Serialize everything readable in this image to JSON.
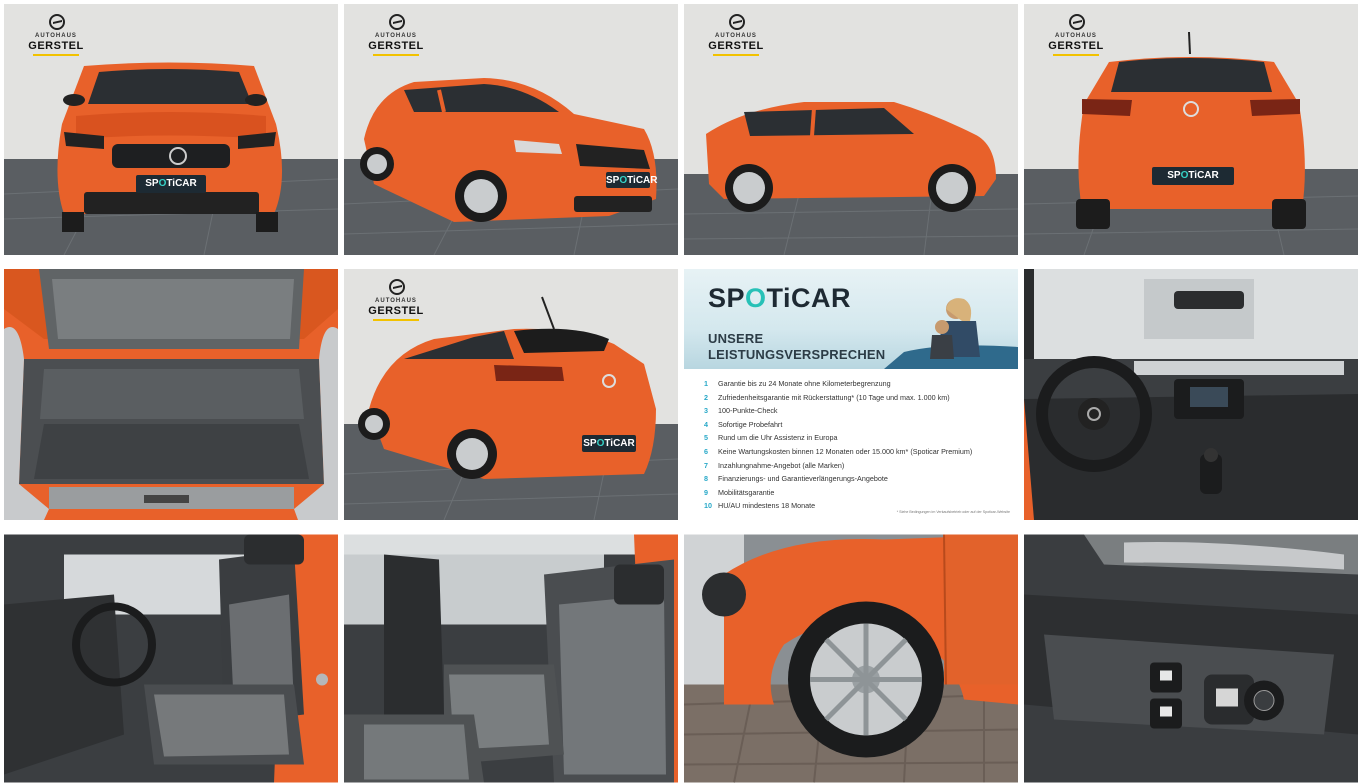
{
  "dealer": {
    "line1": "AUTOHAUS",
    "line2": "GERSTEL"
  },
  "plate": {
    "prefix": "SP",
    "highlight": "O",
    "suffix": "TiCAR"
  },
  "promo": {
    "brand_prefix": "SP",
    "brand_highlight": "O",
    "brand_suffix": "TiCAR",
    "subtitle_line1": "UNSERE",
    "subtitle_line2": "LEISTUNGSVERSPRECHEN",
    "items": [
      {
        "n": "1",
        "text": "Garantie bis zu 24 Monate ohne Kilometerbegrenzung"
      },
      {
        "n": "2",
        "text": "Zufriedenheitsgarantie mit Rückerstattung* (10 Tage und max. 1.000 km)"
      },
      {
        "n": "3",
        "text": "100-Punkte-Check"
      },
      {
        "n": "4",
        "text": "Sofortige Probefahrt"
      },
      {
        "n": "5",
        "text": "Rund um die Uhr Assistenz in Europa"
      },
      {
        "n": "6",
        "text": "Keine Wartungskosten binnen 12 Monaten oder 15.000 km* (Spoticar Premium)"
      },
      {
        "n": "7",
        "text": "Inzahlungnahme-Angebot (alle Marken)"
      },
      {
        "n": "8",
        "text": "Finanzierungs- und Garantieverlängerungs-Angebote"
      },
      {
        "n": "9",
        "text": "Mobilitätsgarantie"
      },
      {
        "n": "10",
        "text": "HU/AU mindestens 18 Monate"
      }
    ],
    "fine_print": "* Siehe Bedingungen im Verkaufsbetrieb oder auf der Spoticar-Website"
  },
  "colors": {
    "car_orange": "#e8612a",
    "spoticar_teal": "#27c1b7",
    "spoticar_dark": "#1e2a33"
  }
}
